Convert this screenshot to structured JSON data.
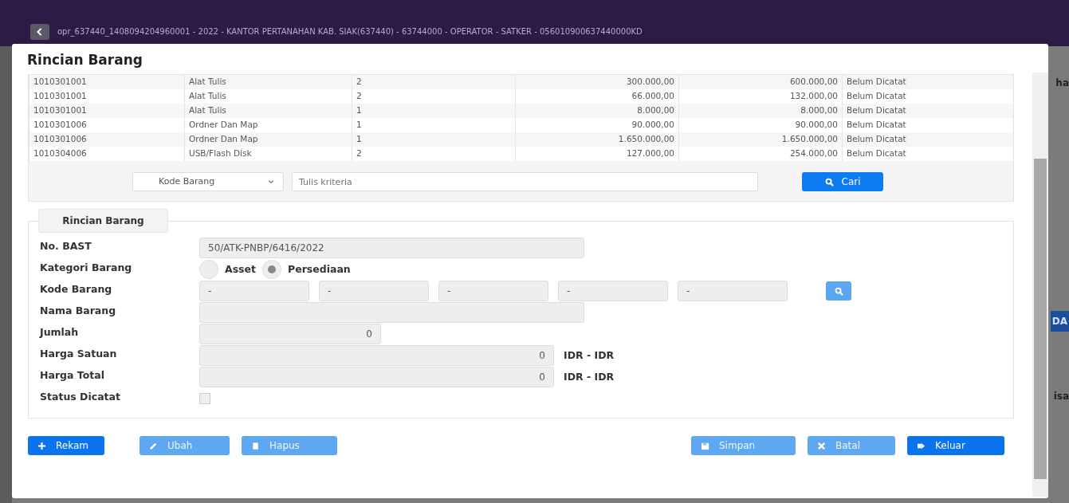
{
  "app_bar": {
    "title": "opr_637440_1408094204960001 - 2022 - KANTOR PERTANAHAN KAB. SIAK(637440) - 63744000 - OPERATOR - SATKER - 056010900637440000KD"
  },
  "background_fragments": [
    "ha",
    "DA",
    "isa"
  ],
  "modal": {
    "title": "Rincian Barang",
    "table": {
      "rows": [
        {
          "cells": [
            "1010301001",
            "Alat Tulis",
            "2",
            "300.000,00",
            "600.000,00",
            "Belum Dicatat"
          ]
        },
        {
          "cells": [
            "1010301001",
            "Alat Tulis",
            "2",
            "66.000,00",
            "132.000,00",
            "Belum Dicatat"
          ]
        },
        {
          "cells": [
            "1010301001",
            "Alat Tulis",
            "1",
            "8.000,00",
            "8.000,00",
            "Belum Dicatat"
          ]
        },
        {
          "cells": [
            "1010301006",
            "Ordner Dan Map",
            "1",
            "90.000,00",
            "90.000,00",
            "Belum Dicatat"
          ]
        },
        {
          "cells": [
            "1010301006",
            "Ordner Dan Map",
            "1",
            "1.650.000,00",
            "1.650.000,00",
            "Belum Dicatat"
          ]
        },
        {
          "cells": [
            "1010304006",
            "USB/Flash Disk",
            "2",
            "127.000,00",
            "254.000,00",
            "Belum Dicatat"
          ]
        }
      ]
    },
    "search": {
      "filter": "Kode Barang",
      "placeholder": "Tulis kriteria",
      "button": "Cari"
    },
    "form": {
      "legend": "Rincian Barang",
      "fields": [
        {
          "kind": "text",
          "label": "No. BAST",
          "value": "50/ATK-PNBP/6416/2022"
        },
        {
          "kind": "radio",
          "label": "Kategori Barang",
          "options": [
            {
              "label": "Asset",
              "selected": false
            },
            {
              "label": "Persediaan",
              "selected": true
            }
          ]
        },
        {
          "kind": "code",
          "label": "Kode Barang",
          "values": [
            "-",
            "-",
            "-",
            "-",
            "-"
          ]
        },
        {
          "kind": "text",
          "label": "Nama Barang"
        },
        {
          "kind": "number",
          "label": "Jumlah",
          "value": "0"
        },
        {
          "kind": "currency",
          "label": "Harga Satuan",
          "value": "0",
          "unit": "IDR - IDR"
        },
        {
          "kind": "currency",
          "label": "Harga Total",
          "value": "0",
          "unit": "IDR - IDR"
        },
        {
          "kind": "checkbox",
          "label": "Status Dicatat",
          "checked": false
        }
      ]
    },
    "buttons": [
      {
        "label": "Rekam",
        "disabled": false
      },
      {
        "label": "Ubah",
        "disabled": true
      },
      {
        "label": "Hapus",
        "disabled": true
      },
      {
        "label": "Simpan",
        "disabled": true
      },
      {
        "label": "Batal",
        "disabled": true
      },
      {
        "label": "Keluar",
        "disabled": false
      }
    ]
  }
}
